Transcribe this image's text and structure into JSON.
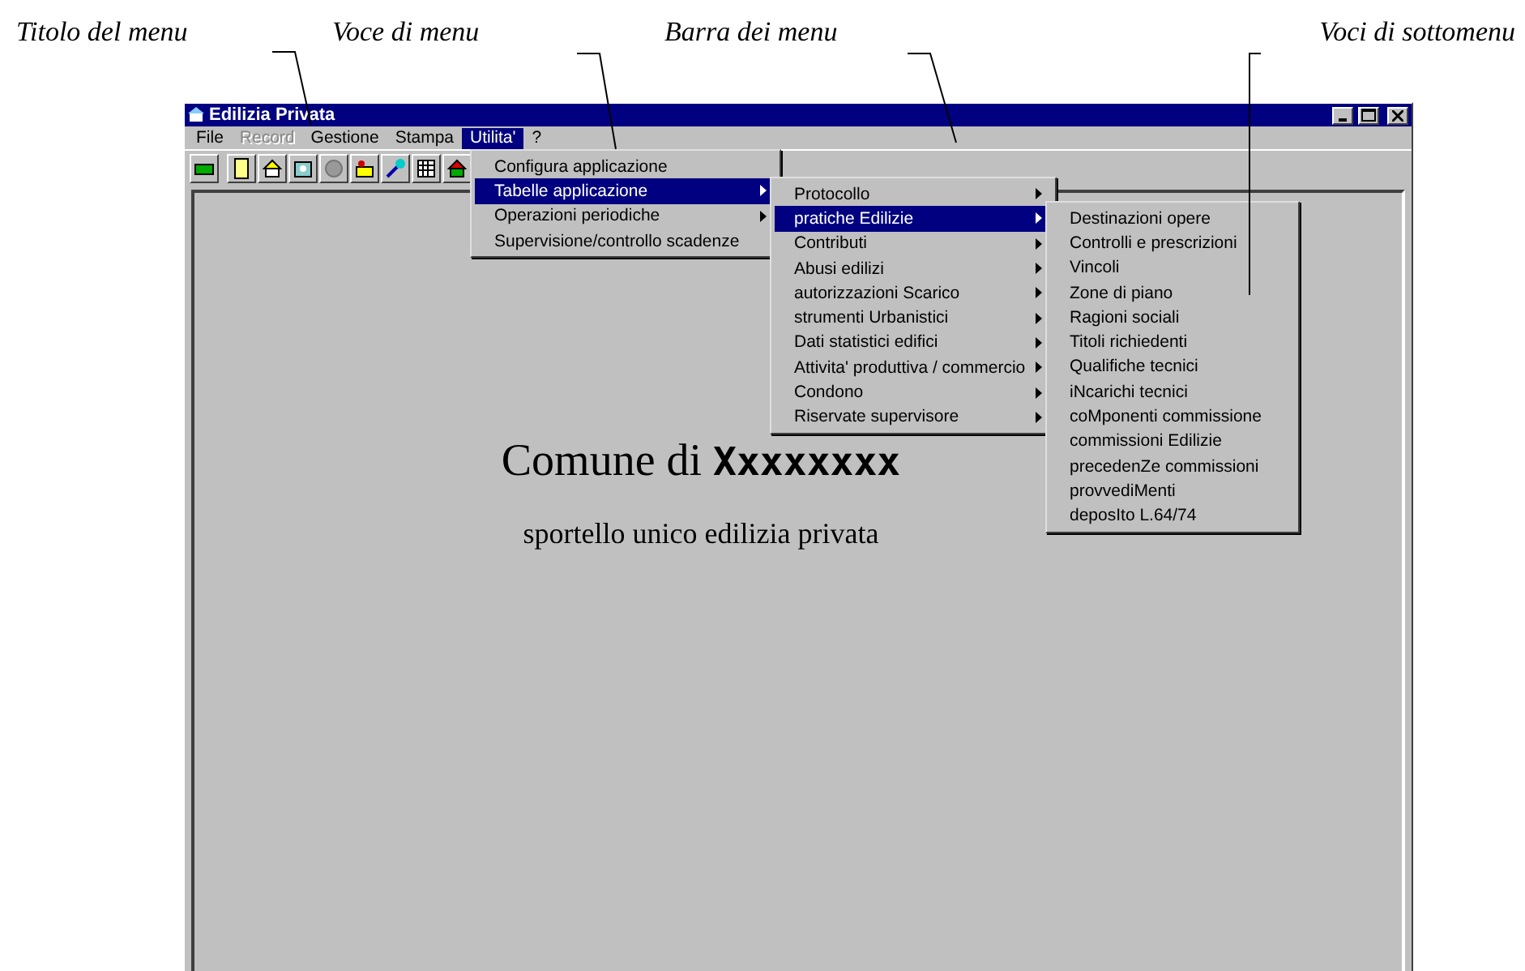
{
  "annotations": [
    {
      "text": "Titolo del menu"
    },
    {
      "text": "Voce di menu"
    },
    {
      "text": "Barra dei menu"
    },
    {
      "text": "Voci di sottomenu"
    }
  ],
  "window": {
    "title": "Edilizia Privata"
  },
  "menu_bar": [
    {
      "label": "File",
      "disabled": false,
      "selected": false
    },
    {
      "label": "Record",
      "disabled": true,
      "selected": false
    },
    {
      "label": "Gestione",
      "disabled": false,
      "selected": false
    },
    {
      "label": "Stampa",
      "disabled": false,
      "selected": false
    },
    {
      "label": "Utilita'",
      "disabled": false,
      "selected": true
    },
    {
      "label": "?",
      "disabled": false,
      "selected": false
    }
  ],
  "menus": [
    {
      "items": [
        {
          "label": "Configura applicazione",
          "submenu": false,
          "selected": false
        },
        {
          "label": "Tabelle applicazione",
          "submenu": true,
          "selected": true
        },
        {
          "label": "Operazioni periodiche",
          "submenu": true,
          "selected": false
        },
        {
          "label": "Supervisione/controllo scadenze",
          "submenu": false,
          "selected": false
        }
      ]
    },
    {
      "items": [
        {
          "label": "Protocollo",
          "submenu": true,
          "selected": false
        },
        {
          "label": "pratiche Edilizie",
          "submenu": true,
          "selected": true
        },
        {
          "label": "Contributi",
          "submenu": true,
          "selected": false
        },
        {
          "label": "Abusi edilizi",
          "submenu": true,
          "selected": false
        },
        {
          "label": "autorizzazioni Scarico",
          "submenu": true,
          "selected": false
        },
        {
          "label": "strumenti Urbanistici",
          "submenu": true,
          "selected": false
        },
        {
          "label": "Dati statistici edifici",
          "submenu": true,
          "selected": false
        },
        {
          "label": "Attivita' produttiva / commercio",
          "submenu": true,
          "selected": false
        },
        {
          "label": "Condono",
          "submenu": true,
          "selected": false
        },
        {
          "label": "Riservate supervisore",
          "submenu": true,
          "selected": false
        }
      ]
    },
    {
      "items": [
        {
          "label": "Destinazioni opere",
          "submenu": false,
          "selected": false
        },
        {
          "label": "Controlli e prescrizioni",
          "submenu": false,
          "selected": false
        },
        {
          "label": "Vincoli",
          "submenu": false,
          "selected": false
        },
        {
          "label": "Zone di piano",
          "submenu": false,
          "selected": false
        },
        {
          "label": "Ragioni sociali",
          "submenu": false,
          "selected": false
        },
        {
          "label": "Titoli richiedenti",
          "submenu": false,
          "selected": false
        },
        {
          "label": "Qualifiche tecnici",
          "submenu": false,
          "selected": false
        },
        {
          "label": "iNcarichi tecnici",
          "submenu": false,
          "selected": false
        },
        {
          "label": "coMponenti commissione",
          "submenu": false,
          "selected": false
        },
        {
          "label": "commissioni Edilizie",
          "submenu": false,
          "selected": false
        },
        {
          "label": "precedenZe commissioni",
          "submenu": false,
          "selected": false
        },
        {
          "label": "provvediMenti",
          "submenu": false,
          "selected": false
        },
        {
          "label": "deposIto L.64/74",
          "submenu": false,
          "selected": false
        }
      ]
    }
  ],
  "content": {
    "heading": "Comune di **Xxxxxxxx**",
    "subtitle": "sportello unico edilizia privata"
  }
}
